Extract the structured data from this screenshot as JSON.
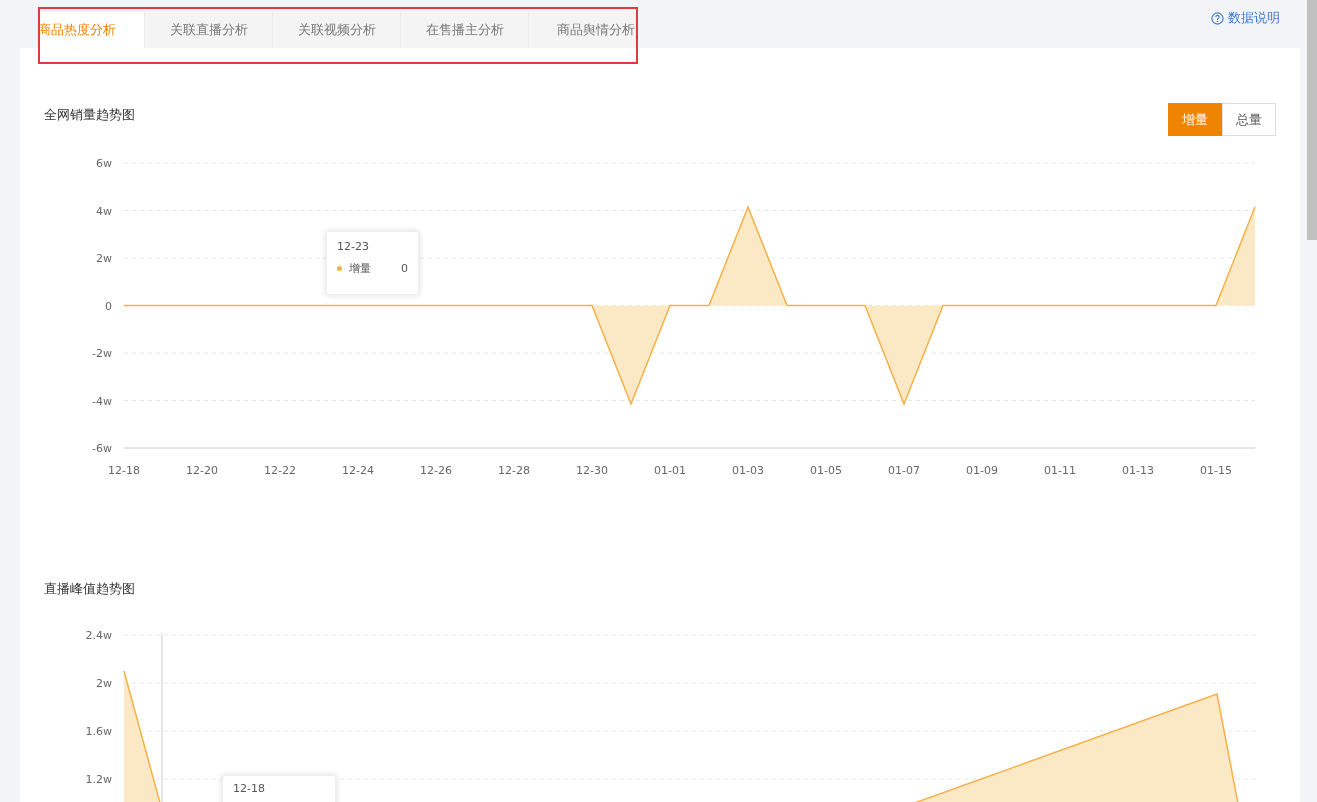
{
  "tabs": [
    {
      "label": "商品热度分析",
      "selected": true
    },
    {
      "label": "关联直播分析",
      "selected": false
    },
    {
      "label": "关联视频分析",
      "selected": false
    },
    {
      "label": "在售播主分析",
      "selected": false
    },
    {
      "label": "商品舆情分析",
      "selected": false
    }
  ],
  "help_link": "数据说明",
  "sales_trend": {
    "title": "全网销量趋势图",
    "toggle": [
      {
        "label": "增量",
        "selected": true
      },
      {
        "label": "总量",
        "selected": false
      }
    ],
    "tooltip": {
      "date": "12-23",
      "series": "增量",
      "value": "0"
    },
    "chart_data": {
      "type": "area",
      "grid": true,
      "categories": [
        "12-18",
        null,
        "12-20",
        null,
        "12-22",
        null,
        "12-24",
        null,
        "12-26",
        null,
        "12-28",
        null,
        "12-30",
        null,
        "01-01",
        null,
        "01-03",
        null,
        "01-05",
        null,
        "01-07",
        null,
        "01-09",
        null,
        "01-11",
        null,
        "01-13",
        null,
        "01-15",
        null
      ],
      "series": [
        {
          "color": "#f5b047",
          "values": [
            0,
            0,
            0,
            0,
            0,
            0,
            0,
            0,
            0,
            0,
            0,
            0,
            0,
            -4.15,
            0,
            0,
            4.15,
            0,
            0,
            0,
            -4.15,
            0,
            0,
            0,
            0,
            0,
            0,
            0,
            0,
            4.15
          ]
        }
      ],
      "yticks": [
        {
          "value": 6,
          "label": "6w"
        },
        {
          "value": 4,
          "label": "4w"
        },
        {
          "value": 2,
          "label": "2w"
        },
        0,
        {
          "value": -2,
          "label": "-2w"
        },
        {
          "value": -4,
          "label": "-4w"
        },
        {
          "value": -6,
          "label": "-6w"
        }
      ],
      "ylim": [
        -6,
        6
      ]
    }
  },
  "live_peak_trend": {
    "title": "直播峰值趋势图",
    "tooltip": {
      "date": "12-18"
    },
    "y_axis_labels": [
      "2.4w",
      "2w",
      "1.6w",
      "1.2w"
    ]
  }
}
